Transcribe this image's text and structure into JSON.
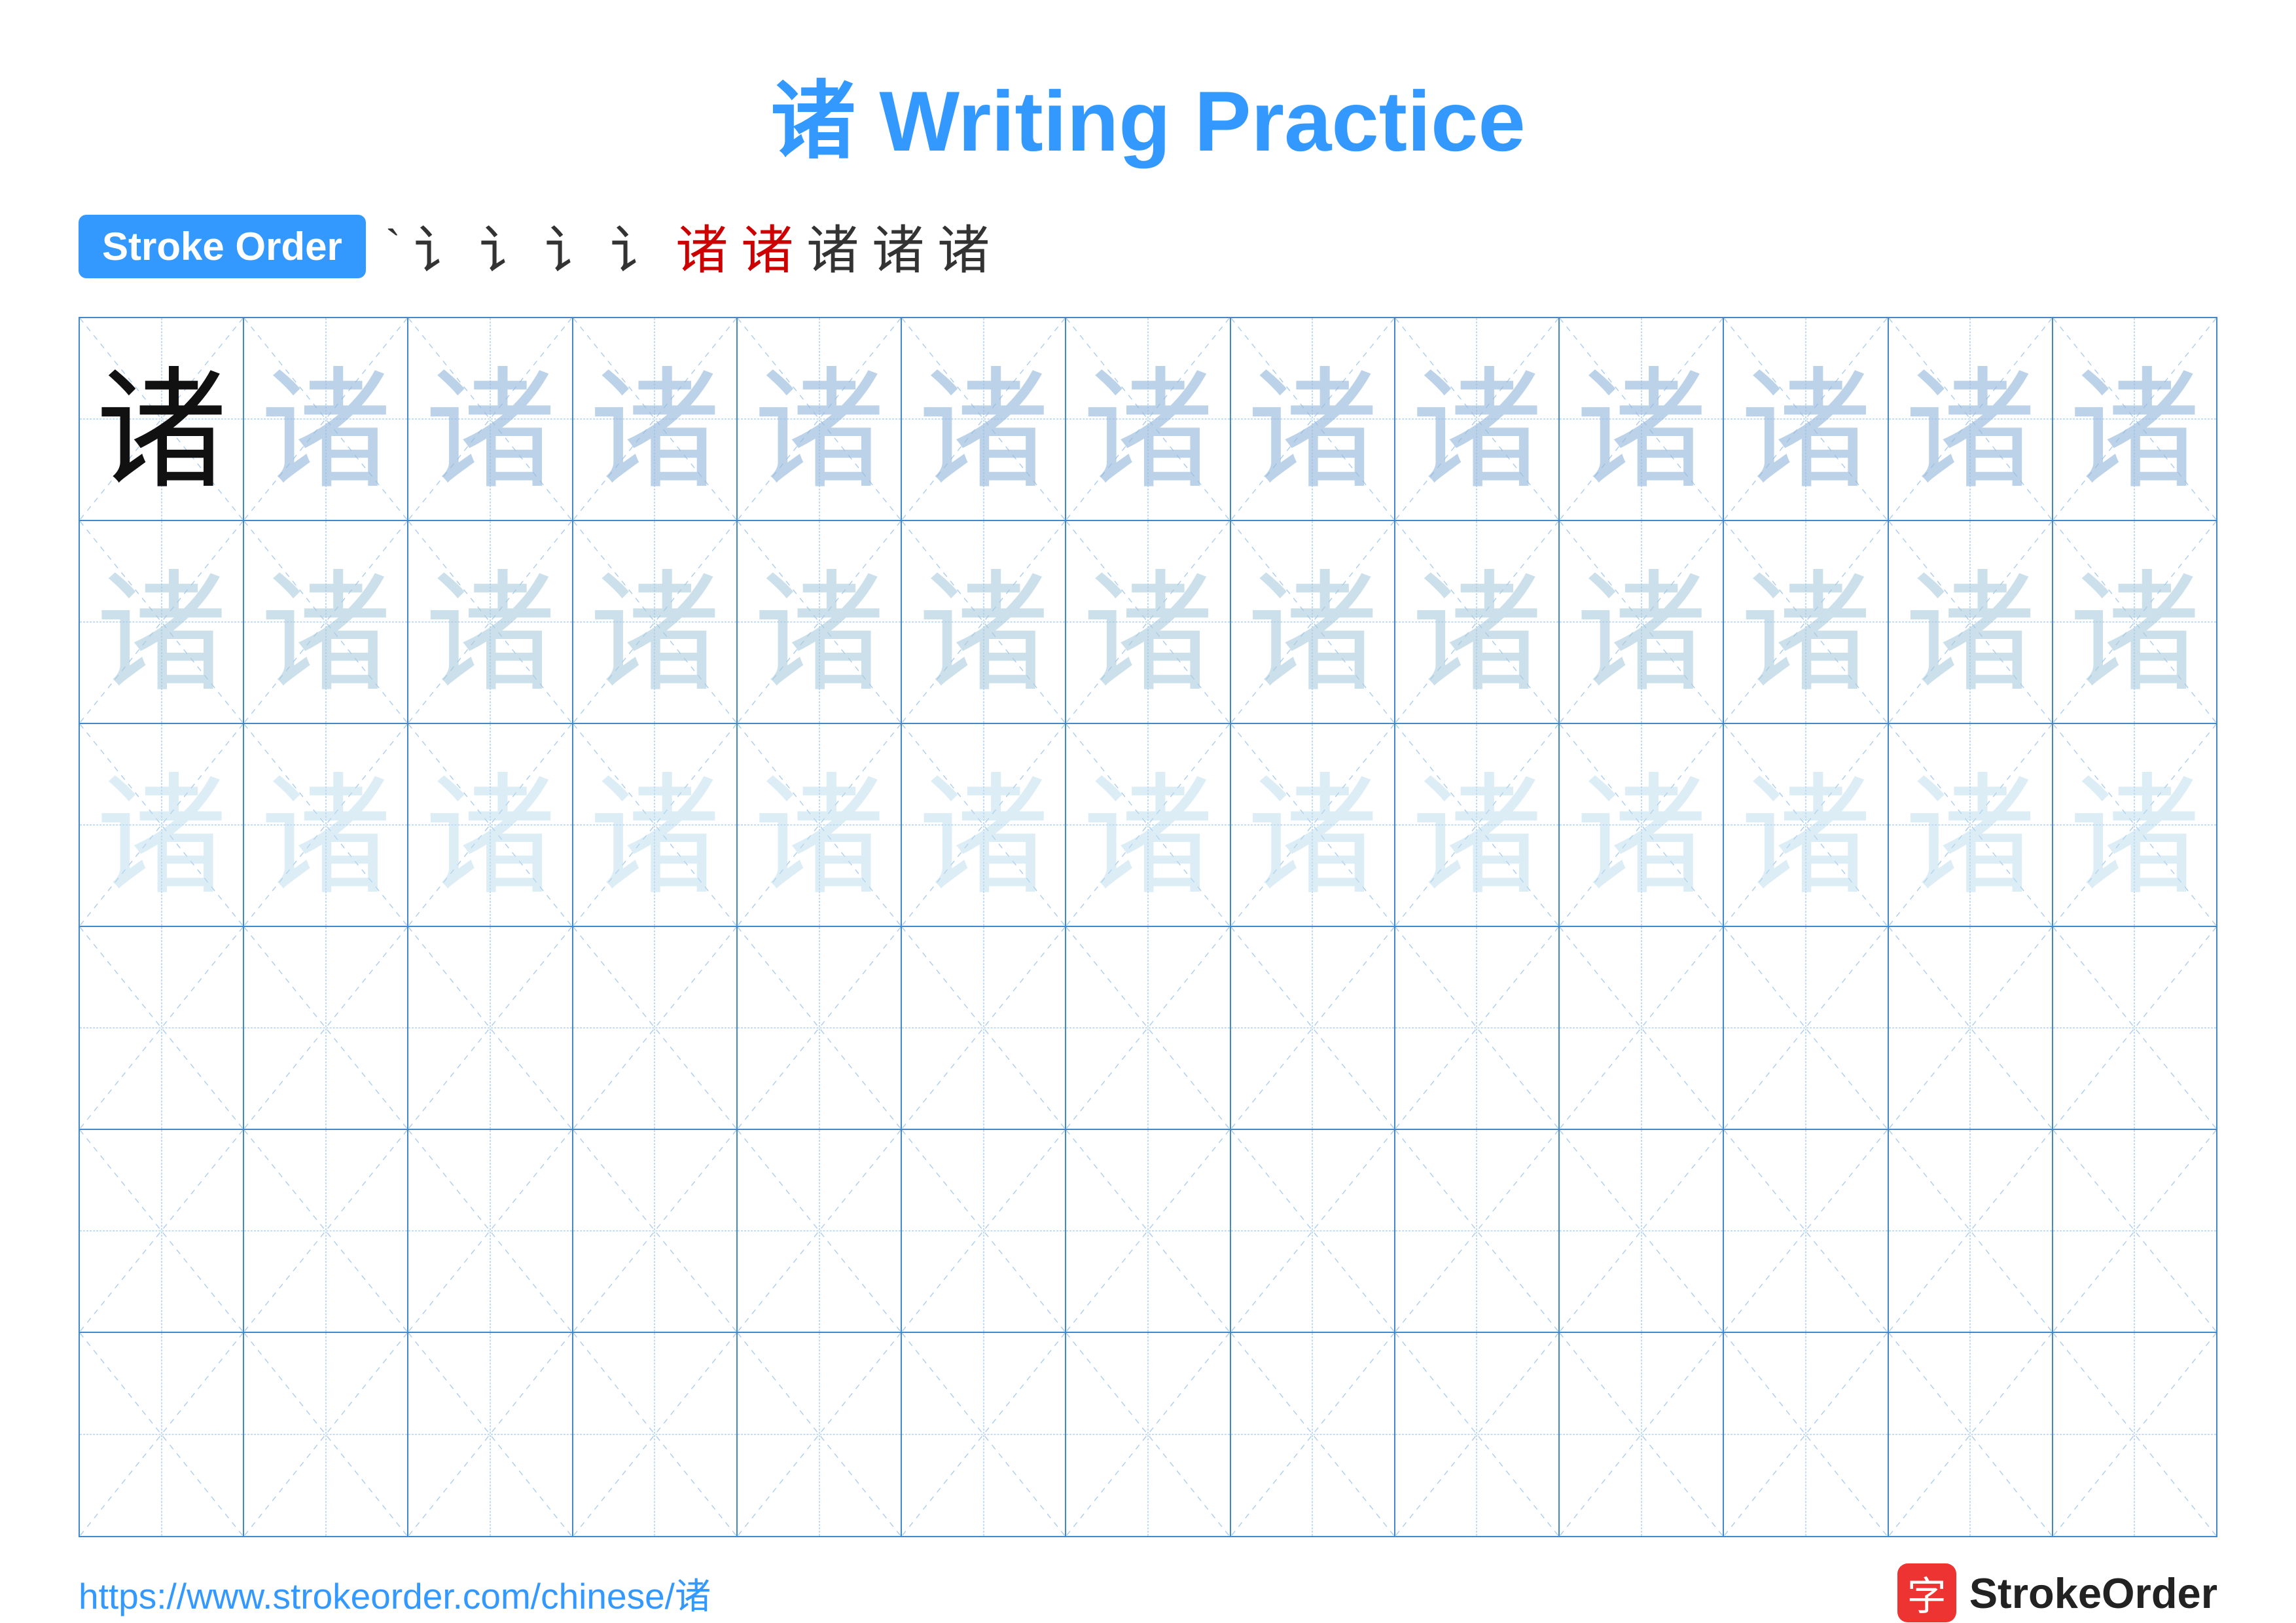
{
  "title": "诸 Writing Practice",
  "stroke_order": {
    "badge_label": "Stroke Order",
    "strokes": [
      "`",
      "i",
      "i⁻",
      "i†",
      "i†",
      "讠†",
      "讠诸",
      "诸",
      "诸",
      "诸"
    ]
  },
  "grid": {
    "rows": 6,
    "cols": 13,
    "row_types": [
      "dark",
      "light",
      "lighter",
      "empty",
      "empty",
      "empty"
    ],
    "char": "诸"
  },
  "footer": {
    "url": "https://www.strokeorder.com/chinese/诸",
    "logo_char": "字",
    "logo_text": "StrokeOrder"
  }
}
